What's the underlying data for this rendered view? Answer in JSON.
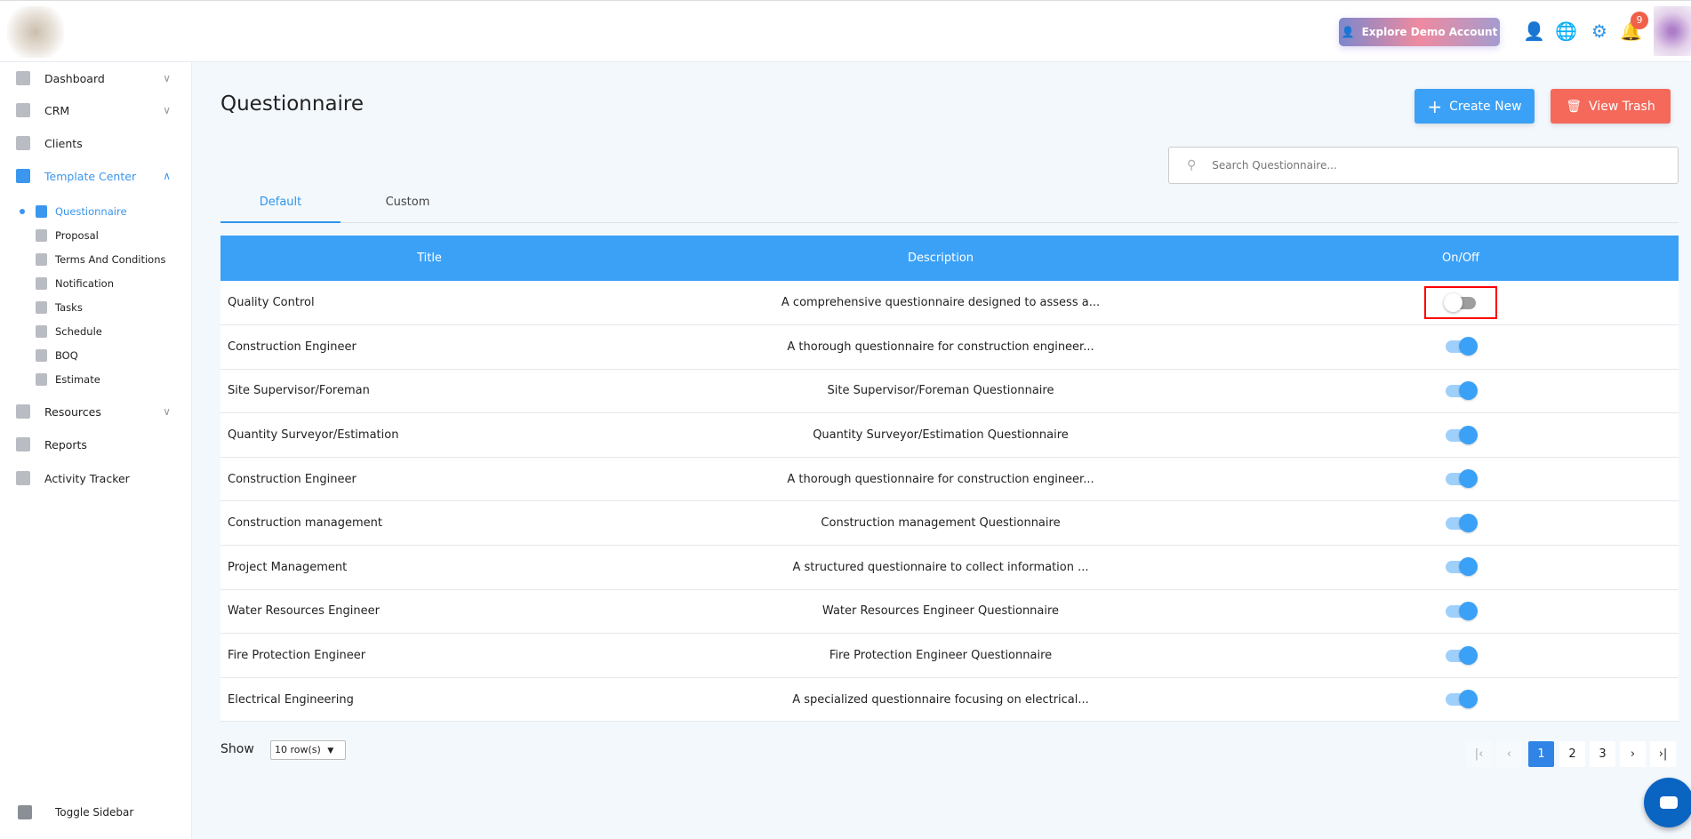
{
  "header": {
    "demo_label": "Explore Demo Account",
    "notification_count": "9"
  },
  "sidebar": {
    "items": [
      {
        "label": "Dashboard"
      },
      {
        "label": "CRM"
      },
      {
        "label": "Clients"
      },
      {
        "label": "Template Center"
      },
      {
        "label": "Resources"
      },
      {
        "label": "Reports"
      },
      {
        "label": "Activity Tracker"
      }
    ],
    "sub_items": [
      {
        "label": "Questionnaire"
      },
      {
        "label": "Proposal"
      },
      {
        "label": "Terms And Conditions"
      },
      {
        "label": "Notification"
      },
      {
        "label": "Tasks"
      },
      {
        "label": "Schedule"
      },
      {
        "label": "BOQ"
      },
      {
        "label": "Estimate"
      }
    ],
    "toggle_label": "Toggle Sidebar"
  },
  "page": {
    "title": "Questionnaire",
    "create_label": "Create New",
    "trash_label": "View Trash",
    "search_placeholder": "Search Questionnaire...",
    "tabs": [
      {
        "label": "Default"
      },
      {
        "label": "Custom"
      }
    ]
  },
  "table": {
    "headers": [
      "Title",
      "Description",
      "On/Off"
    ],
    "rows": [
      {
        "title": "Quality Control",
        "description": "A comprehensive questionnaire designed to assess a...",
        "on": false
      },
      {
        "title": "Construction Engineer",
        "description": "A thorough questionnaire for construction engineer...",
        "on": true
      },
      {
        "title": "Site Supervisor/Foreman",
        "description": "Site Supervisor/Foreman Questionnaire",
        "on": true
      },
      {
        "title": "Quantity Surveyor/Estimation",
        "description": "Quantity Surveyor/Estimation Questionnaire",
        "on": true
      },
      {
        "title": "Construction Engineer",
        "description": "A thorough questionnaire for construction engineer...",
        "on": true
      },
      {
        "title": "Construction management",
        "description": "Construction management Questionnaire",
        "on": true
      },
      {
        "title": "Project Management",
        "description": "A structured questionnaire to collect information ...",
        "on": true
      },
      {
        "title": "Water Resources Engineer",
        "description": "Water Resources Engineer Questionnaire",
        "on": true
      },
      {
        "title": "Fire Protection Engineer",
        "description": "Fire Protection Engineer Questionnaire",
        "on": true
      },
      {
        "title": "Electrical Engineering",
        "description": "A specialized questionnaire focusing on electrical...",
        "on": true
      }
    ]
  },
  "footer": {
    "show_label": "Show",
    "rows_value": "10 row(s)",
    "pages": [
      "1",
      "2",
      "3"
    ],
    "current_page": "1"
  }
}
